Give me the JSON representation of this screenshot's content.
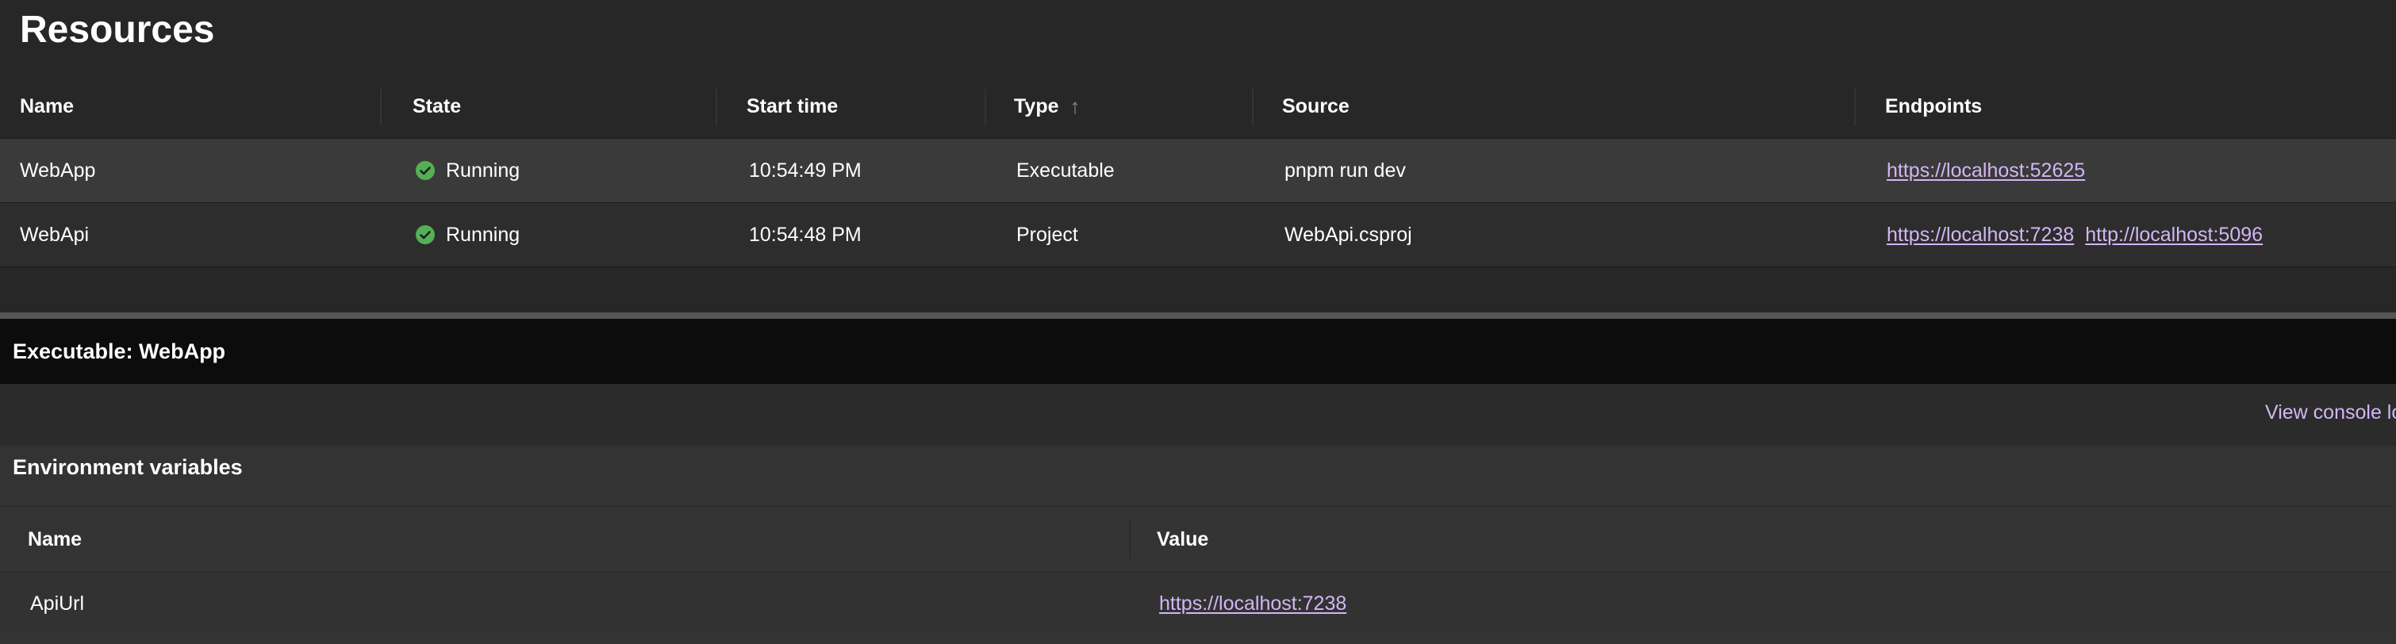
{
  "page": {
    "title": "Resources"
  },
  "resources_table": {
    "columns": {
      "name": "Name",
      "state": "State",
      "start_time": "Start time",
      "type": "Type",
      "source": "Source",
      "endpoints": "Endpoints"
    },
    "sort_icon": "arrow-up-icon",
    "rows": [
      {
        "name": "WebApp",
        "state": "Running",
        "state_icon": "check-circle-icon",
        "start_time": "10:54:49 PM",
        "type": "Executable",
        "source": "pnpm run dev",
        "endpoints": [
          "https://localhost:52625"
        ]
      },
      {
        "name": "WebApi",
        "state": "Running",
        "state_icon": "check-circle-icon",
        "start_time": "10:54:48 PM",
        "type": "Project",
        "source": "WebApi.csproj",
        "endpoints": [
          "https://localhost:7238",
          "http://localhost:5096"
        ]
      }
    ]
  },
  "details": {
    "title": "Executable: WebApp",
    "view_console_label": "View console logs",
    "env_section": {
      "title": "Environment variables",
      "columns": {
        "name": "Name",
        "value": "Value"
      },
      "rows": [
        {
          "name": "ApiUrl",
          "value": "https://localhost:7238"
        }
      ]
    }
  },
  "colors": {
    "background": "#272727",
    "link": "#d2b6f5",
    "running": "#54b054",
    "details_header": "#0c0c0c"
  }
}
